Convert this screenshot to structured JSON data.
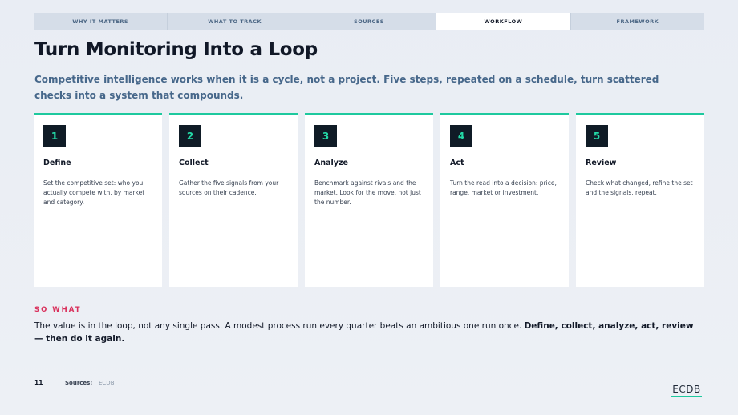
{
  "tabs": [
    {
      "label": "WHY IT MATTERS"
    },
    {
      "label": "WHAT TO TRACK"
    },
    {
      "label": "SOURCES"
    },
    {
      "label": "WORKFLOW"
    },
    {
      "label": "FRAMEWORK"
    }
  ],
  "active_tab": "WORKFLOW",
  "title": "Turn Monitoring Into a Loop",
  "subtitle": "Competitive intelligence works when it is a cycle, not a project. Five steps, repeated on a schedule, turn scattered checks into a system that compounds.",
  "steps": [
    {
      "num": "1",
      "title": "Define",
      "text": "Set the competitive set: who you actually compete with, by market and category."
    },
    {
      "num": "2",
      "title": "Collect",
      "text": "Gather the five signals from your sources on their cadence."
    },
    {
      "num": "3",
      "title": "Analyze",
      "text": "Benchmark against rivals and the market. Look for the move, not just the number."
    },
    {
      "num": "4",
      "title": "Act",
      "text": "Turn the read into a decision: price, range, market or investment."
    },
    {
      "num": "5",
      "title": "Review",
      "text": "Check what changed, refine the set and the signals, repeat."
    }
  ],
  "so_what": {
    "label": "SO WHAT",
    "text": "The value is in the loop, not any single pass. A modest process run every quarter beats an ambitious one run once. ",
    "emphasis": "Define, collect, analyze, act, review — then do it again."
  },
  "footer": {
    "page_number": "11",
    "sources_label": "Sources:",
    "sources": "ECDB",
    "logo": "ECDB"
  },
  "colors": {
    "accent": "#1ec99e",
    "label_red": "#d92f5b",
    "subtitle_blue": "#46678a",
    "dark": "#0f1b26"
  }
}
